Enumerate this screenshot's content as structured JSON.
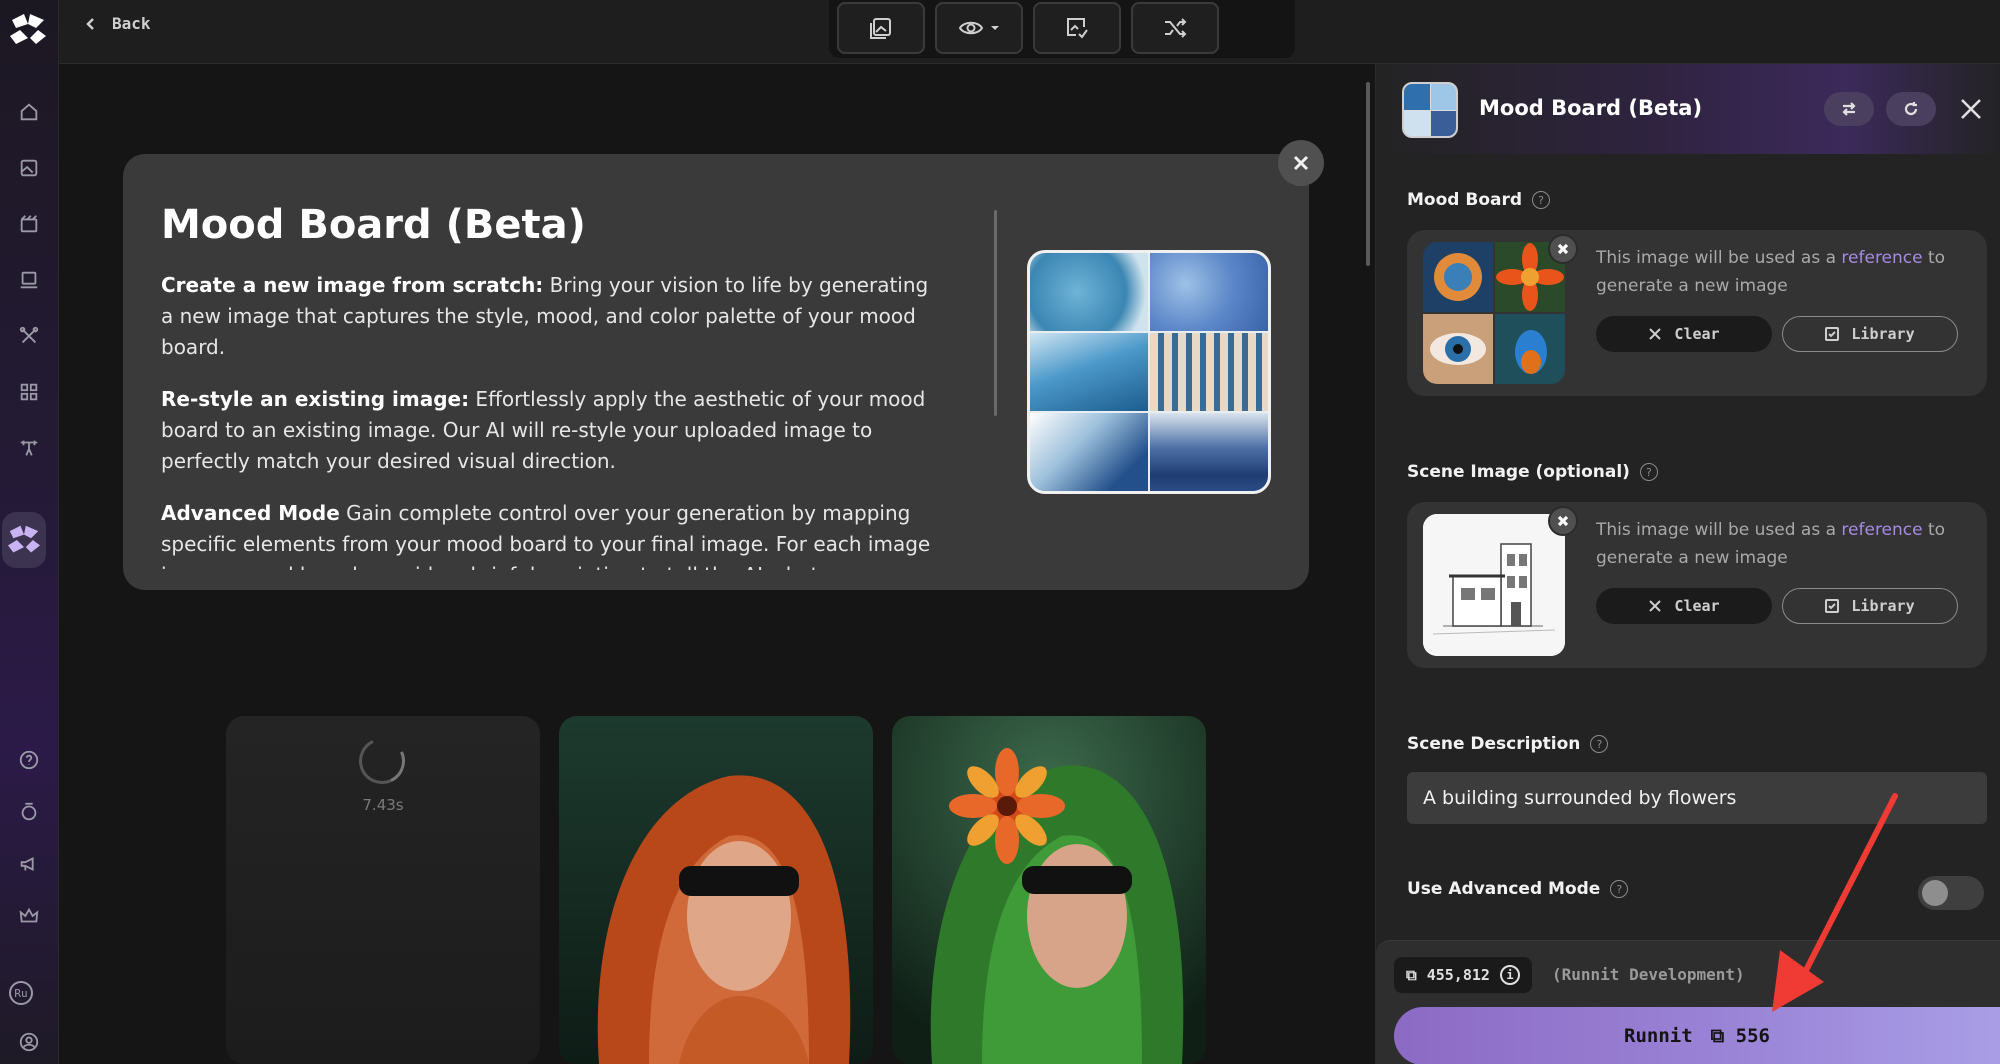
{
  "topbar": {
    "back_label": "Back",
    "tools": [
      "gallery-icon",
      "eye-icon",
      "image-check-icon",
      "shuffle-icon"
    ]
  },
  "sidebar": {
    "items": [
      "home-icon",
      "images-icon",
      "video-icon",
      "monitor-icon",
      "tools-icon",
      "apps-icon",
      "dumbbell-icon",
      "logo-active-icon"
    ],
    "bottom": [
      "help-icon",
      "badge-icon",
      "megaphone-icon",
      "crown-icon",
      "Ru",
      "user-icon"
    ]
  },
  "info_card": {
    "title": "Mood Board (Beta)",
    "p1_bold": "Create a new image from scratch:",
    "p1_text": " Bring your vision to life by generating a new image that captures the style, mood, and color palette of your mood board.",
    "p2_bold": "Re-style an existing image:",
    "p2_text": " Effortlessly apply the aesthetic of your mood board to an existing image. Our AI will re-style your uploaded image to perfectly match your desired visual direction.",
    "p3_bold": "Advanced Mode",
    "p3_text": " Gain complete control over your generation by mapping specific elements from your mood board to your final image. For each image in your mood board, provide a brief description to tell the AI what you are"
  },
  "results": {
    "loading_time": "7.43s"
  },
  "panel": {
    "title": "Mood Board (Beta)",
    "mood_board": {
      "label": "Mood Board",
      "desc_before": "This image will be used as a ",
      "desc_link": "reference",
      "desc_after": " to generate a new image",
      "clear_label": "Clear",
      "library_label": "Library"
    },
    "scene_image": {
      "label": "Scene Image (optional)",
      "desc_before": "This image will be used as a ",
      "desc_link": "reference",
      "desc_after": " to generate a new image",
      "clear_label": "Clear",
      "library_label": "Library"
    },
    "scene_description": {
      "label": "Scene Description",
      "value": "A building surrounded by flowers"
    },
    "advanced_mode": {
      "label": "Use Advanced Mode",
      "enabled": false
    },
    "credits": {
      "balance": "455,812",
      "org": "(Runnit Development)"
    },
    "run_button": {
      "label": "Runnit",
      "cost": "556"
    }
  },
  "colors": {
    "accent": "#9b86d8",
    "link": "#a58be0",
    "annotation_arrow": "#ef3b33"
  }
}
